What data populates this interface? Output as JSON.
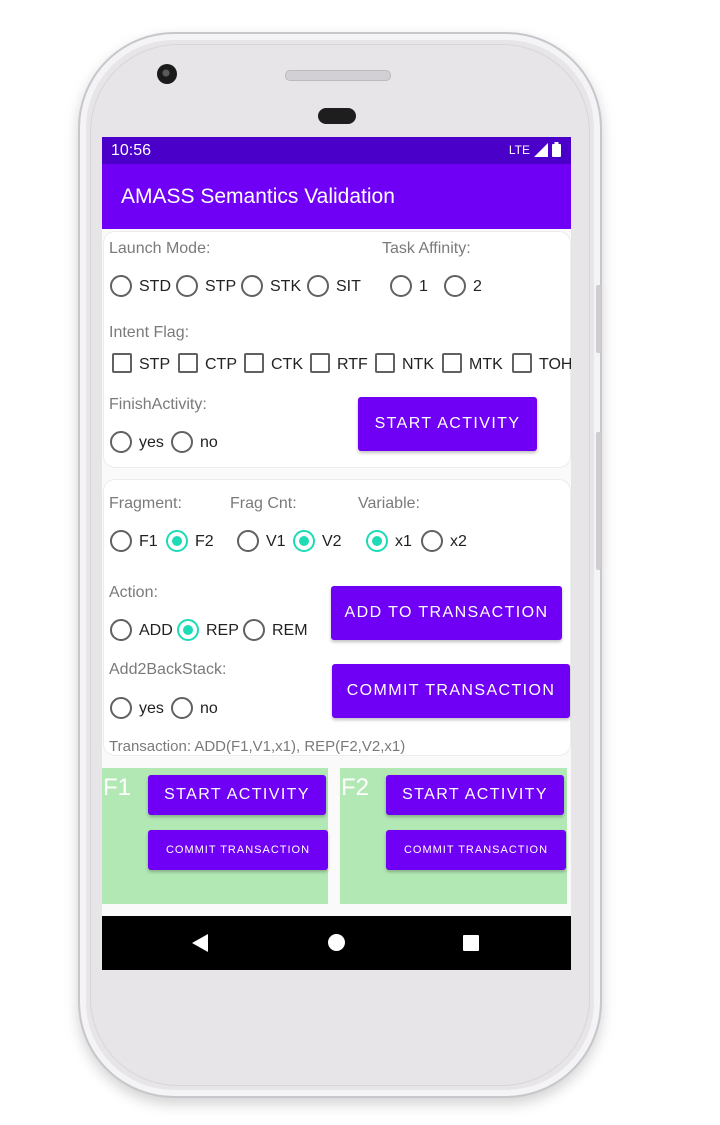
{
  "status": {
    "time": "10:56",
    "network": "LTE"
  },
  "app": {
    "title": "AMASS Semantics Validation"
  },
  "activity_card": {
    "launch_mode_label": "Launch Mode:",
    "launch_modes": [
      "STD",
      "STP",
      "STK",
      "SIT"
    ],
    "task_affinity_label": "Task Affinity:",
    "task_affinities": [
      "1",
      "2"
    ],
    "intent_flag_label": "Intent Flag:",
    "intent_flags": [
      "STP",
      "CTP",
      "CTK",
      "RTF",
      "NTK",
      "MTK",
      "TOH"
    ],
    "finish_activity_label": "FinishActivity:",
    "finish_options": [
      "yes",
      "no"
    ],
    "start_activity_button": "START ACTIVITY"
  },
  "fragment_card": {
    "fragment_label": "Fragment:",
    "fragments": [
      "F1",
      "F2"
    ],
    "fragments_selected": "F2",
    "frag_cnt_label": "Frag Cnt:",
    "frag_cnts": [
      "V1",
      "V2"
    ],
    "frag_cnt_selected": "V2",
    "variable_label": "Variable:",
    "variables": [
      "x1",
      "x2"
    ],
    "variable_selected": "x1",
    "action_label": "Action:",
    "actions": [
      "ADD",
      "REP",
      "REM"
    ],
    "action_selected": "REP",
    "add_to_transaction_button": "ADD TO TRANSACTION",
    "backstack_label": "Add2BackStack:",
    "backstack_options": [
      "yes",
      "no"
    ],
    "commit_transaction_button": "COMMIT TRANSACTION",
    "transaction_text": "Transaction: ADD(F1,V1,x1), REP(F2,V2,x1)"
  },
  "fragments_view": [
    {
      "tag": "F1",
      "start_button": "START ACTIVITY",
      "commit_button": "COMMIT TRANSACTION"
    },
    {
      "tag": "F2",
      "start_button": "START ACTIVITY",
      "commit_button": "COMMIT TRANSACTION"
    }
  ],
  "colors": {
    "primary": "#7000f5",
    "status_bar": "#4a00c9",
    "accent": "#1ddcb5",
    "fragment_bg": "#b2e8b4"
  },
  "icons": [
    "signal-icon",
    "battery-icon",
    "nav-back-icon",
    "nav-home-icon",
    "nav-recents-icon"
  ]
}
